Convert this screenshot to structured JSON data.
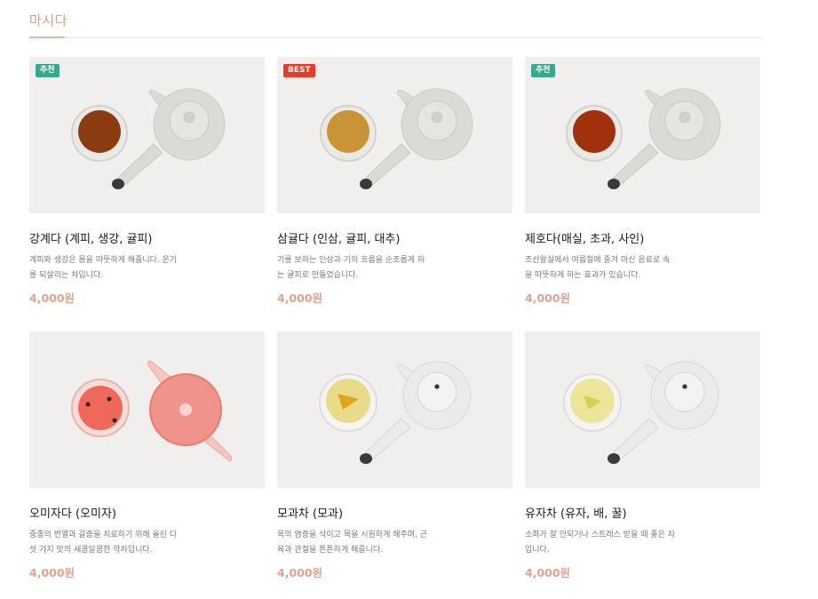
{
  "section": {
    "title": "마시다"
  },
  "products": [
    {
      "badge": "추천",
      "badge_type": "rec",
      "name": "강계다 (계피, 생강, 귤피)",
      "desc_line1": "계피와 생강은 몸을 따뜻하게 해줍니다. 온기",
      "desc_line2": "를 되살리는 차입니다.",
      "price": "4,000원",
      "tea_color": "#8a3b10",
      "pot_color": "#d9dcd6"
    },
    {
      "badge": "BEST",
      "badge_type": "best",
      "name": "삼귤다 (인삼, 귤피, 대추)",
      "desc_line1": "기를 보하는 인삼과 기의 흐름을 순조롭게 하",
      "desc_line2": "는 귤피로 만들었습니다.",
      "price": "4,000원",
      "tea_color": "#c99436",
      "pot_color": "#d9dcd6"
    },
    {
      "badge": "추천",
      "badge_type": "rec",
      "name": "제호다(매실, 초과, 사인)",
      "desc_line1": "조선왕실에서 여름철에 즐겨 마신 음료로 속",
      "desc_line2": "을 따뜻하게 하는 효과가 있습니다.",
      "price": "4,000원",
      "tea_color": "#a1300c",
      "pot_color": "#d9dcd6"
    },
    {
      "badge": "",
      "badge_type": "",
      "name": "오미자다 (오미자)",
      "desc_line1": "중종의 번열과 갈증을 치료하기 위해 올린 다",
      "desc_line2": "섯 가지 맛의 새콤달콤한 약차입니다.",
      "price": "4,000원",
      "tea_color": "#ef5a4e",
      "pot_color": "#f08a80"
    },
    {
      "badge": "",
      "badge_type": "",
      "name": "모과차 (모과)",
      "desc_line1": "목의 염증을 삭이고 목을 시원하게 해주며, 근",
      "desc_line2": "육과 관절을 튼튼하게 해줍니다.",
      "price": "4,000원",
      "tea_color": "#eadb8a",
      "pot_color": "#ebebea"
    },
    {
      "badge": "",
      "badge_type": "",
      "name": "유자차 (유자, 배, 꿀)",
      "desc_line1": "소화가 잘 안되거나 스트레스 받을 때 좋은 차",
      "desc_line2": "입니다.",
      "price": "4,000원",
      "tea_color": "#ece69a",
      "pot_color": "#ebebea"
    }
  ]
}
